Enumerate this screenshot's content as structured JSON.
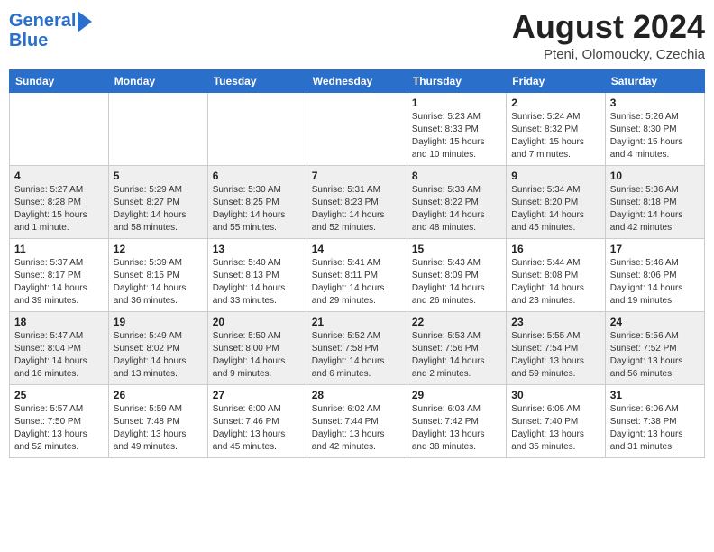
{
  "header": {
    "logo_line1": "General",
    "logo_line2": "Blue",
    "month": "August 2024",
    "location": "Pteni, Olomoucky, Czechia"
  },
  "days_of_week": [
    "Sunday",
    "Monday",
    "Tuesday",
    "Wednesday",
    "Thursday",
    "Friday",
    "Saturday"
  ],
  "weeks": [
    [
      {
        "num": "",
        "info": ""
      },
      {
        "num": "",
        "info": ""
      },
      {
        "num": "",
        "info": ""
      },
      {
        "num": "",
        "info": ""
      },
      {
        "num": "1",
        "info": "Sunrise: 5:23 AM\nSunset: 8:33 PM\nDaylight: 15 hours\nand 10 minutes."
      },
      {
        "num": "2",
        "info": "Sunrise: 5:24 AM\nSunset: 8:32 PM\nDaylight: 15 hours\nand 7 minutes."
      },
      {
        "num": "3",
        "info": "Sunrise: 5:26 AM\nSunset: 8:30 PM\nDaylight: 15 hours\nand 4 minutes."
      }
    ],
    [
      {
        "num": "4",
        "info": "Sunrise: 5:27 AM\nSunset: 8:28 PM\nDaylight: 15 hours\nand 1 minute."
      },
      {
        "num": "5",
        "info": "Sunrise: 5:29 AM\nSunset: 8:27 PM\nDaylight: 14 hours\nand 58 minutes."
      },
      {
        "num": "6",
        "info": "Sunrise: 5:30 AM\nSunset: 8:25 PM\nDaylight: 14 hours\nand 55 minutes."
      },
      {
        "num": "7",
        "info": "Sunrise: 5:31 AM\nSunset: 8:23 PM\nDaylight: 14 hours\nand 52 minutes."
      },
      {
        "num": "8",
        "info": "Sunrise: 5:33 AM\nSunset: 8:22 PM\nDaylight: 14 hours\nand 48 minutes."
      },
      {
        "num": "9",
        "info": "Sunrise: 5:34 AM\nSunset: 8:20 PM\nDaylight: 14 hours\nand 45 minutes."
      },
      {
        "num": "10",
        "info": "Sunrise: 5:36 AM\nSunset: 8:18 PM\nDaylight: 14 hours\nand 42 minutes."
      }
    ],
    [
      {
        "num": "11",
        "info": "Sunrise: 5:37 AM\nSunset: 8:17 PM\nDaylight: 14 hours\nand 39 minutes."
      },
      {
        "num": "12",
        "info": "Sunrise: 5:39 AM\nSunset: 8:15 PM\nDaylight: 14 hours\nand 36 minutes."
      },
      {
        "num": "13",
        "info": "Sunrise: 5:40 AM\nSunset: 8:13 PM\nDaylight: 14 hours\nand 33 minutes."
      },
      {
        "num": "14",
        "info": "Sunrise: 5:41 AM\nSunset: 8:11 PM\nDaylight: 14 hours\nand 29 minutes."
      },
      {
        "num": "15",
        "info": "Sunrise: 5:43 AM\nSunset: 8:09 PM\nDaylight: 14 hours\nand 26 minutes."
      },
      {
        "num": "16",
        "info": "Sunrise: 5:44 AM\nSunset: 8:08 PM\nDaylight: 14 hours\nand 23 minutes."
      },
      {
        "num": "17",
        "info": "Sunrise: 5:46 AM\nSunset: 8:06 PM\nDaylight: 14 hours\nand 19 minutes."
      }
    ],
    [
      {
        "num": "18",
        "info": "Sunrise: 5:47 AM\nSunset: 8:04 PM\nDaylight: 14 hours\nand 16 minutes."
      },
      {
        "num": "19",
        "info": "Sunrise: 5:49 AM\nSunset: 8:02 PM\nDaylight: 14 hours\nand 13 minutes."
      },
      {
        "num": "20",
        "info": "Sunrise: 5:50 AM\nSunset: 8:00 PM\nDaylight: 14 hours\nand 9 minutes."
      },
      {
        "num": "21",
        "info": "Sunrise: 5:52 AM\nSunset: 7:58 PM\nDaylight: 14 hours\nand 6 minutes."
      },
      {
        "num": "22",
        "info": "Sunrise: 5:53 AM\nSunset: 7:56 PM\nDaylight: 14 hours\nand 2 minutes."
      },
      {
        "num": "23",
        "info": "Sunrise: 5:55 AM\nSunset: 7:54 PM\nDaylight: 13 hours\nand 59 minutes."
      },
      {
        "num": "24",
        "info": "Sunrise: 5:56 AM\nSunset: 7:52 PM\nDaylight: 13 hours\nand 56 minutes."
      }
    ],
    [
      {
        "num": "25",
        "info": "Sunrise: 5:57 AM\nSunset: 7:50 PM\nDaylight: 13 hours\nand 52 minutes."
      },
      {
        "num": "26",
        "info": "Sunrise: 5:59 AM\nSunset: 7:48 PM\nDaylight: 13 hours\nand 49 minutes."
      },
      {
        "num": "27",
        "info": "Sunrise: 6:00 AM\nSunset: 7:46 PM\nDaylight: 13 hours\nand 45 minutes."
      },
      {
        "num": "28",
        "info": "Sunrise: 6:02 AM\nSunset: 7:44 PM\nDaylight: 13 hours\nand 42 minutes."
      },
      {
        "num": "29",
        "info": "Sunrise: 6:03 AM\nSunset: 7:42 PM\nDaylight: 13 hours\nand 38 minutes."
      },
      {
        "num": "30",
        "info": "Sunrise: 6:05 AM\nSunset: 7:40 PM\nDaylight: 13 hours\nand 35 minutes."
      },
      {
        "num": "31",
        "info": "Sunrise: 6:06 AM\nSunset: 7:38 PM\nDaylight: 13 hours\nand 31 minutes."
      }
    ]
  ]
}
